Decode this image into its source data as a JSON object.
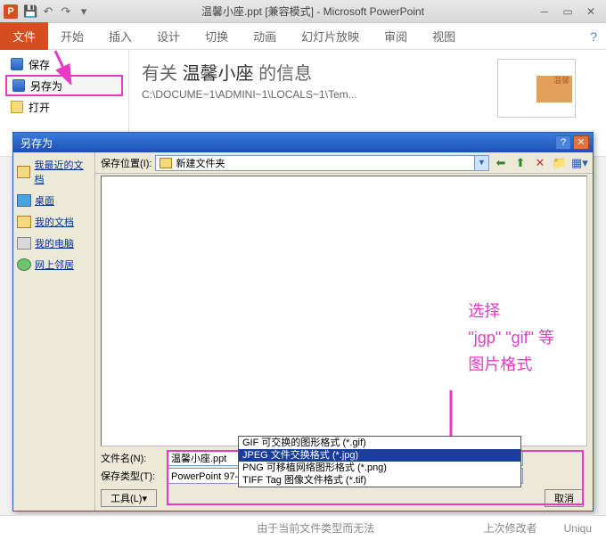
{
  "titlebar": {
    "app_letter": "P",
    "title": "温馨小座.ppt [兼容模式] - Microsoft PowerPoint"
  },
  "ribbon": {
    "tabs": [
      "文件",
      "开始",
      "插入",
      "设计",
      "切换",
      "动画",
      "幻灯片放映",
      "审阅",
      "视图"
    ]
  },
  "backstage": {
    "items": {
      "save": "保存",
      "saveas": "另存为",
      "open": "打开"
    },
    "heading_prefix": "有关 ",
    "heading_name": "温馨小座",
    "heading_suffix": " 的信息",
    "path": "C:\\DOCUME~1\\ADMINI~1\\LOCALS~1\\Tem..."
  },
  "dialog": {
    "title": "另存为",
    "save_in_label": "保存位置(I):",
    "save_in_value": "新建文件夹",
    "places": {
      "recent": "我最近的文档",
      "desktop": "桌面",
      "mydocs": "我的文档",
      "mycomputer": "我的电脑",
      "network": "网上邻居"
    },
    "filename_label": "文件名(N):",
    "filename_value": "温馨小座.ppt",
    "savetype_label": "保存类型(T):",
    "savetype_value": "PowerPoint 97-2003 演示文稿 (*.ppt)",
    "type_options": {
      "gif": "GIF 可交换的图形格式 (*.gif)",
      "jpeg": "JPEG 文件交换格式 (*.jpg)",
      "png": "PNG 可移植网络图形格式 (*.png)",
      "tiff": "TIFF Tag 图像文件格式 (*.tif)"
    },
    "tools_btn": "工具(L)",
    "cancel_btn": "取消"
  },
  "annotation": {
    "line1": "选择",
    "line2": "\"jgp\" \"gif\" 等",
    "line3": "图片格式"
  },
  "footer": {
    "text1": "由于当前文件类型而无法",
    "text2": "上次修改者",
    "text3": "Uniqu"
  }
}
